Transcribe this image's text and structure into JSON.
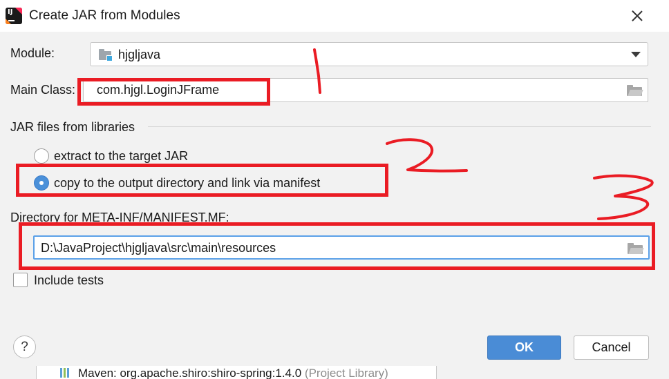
{
  "window": {
    "title": "Create JAR from Modules",
    "app_icon": "intellij-idea-icon"
  },
  "module": {
    "label": "Module:",
    "value": "hjgljava",
    "icon": "module-folder-icon"
  },
  "main_class": {
    "label": "Main Class:",
    "value": "com.hjgl.LoginJFrame"
  },
  "jar_libraries": {
    "section_title": "JAR files from libraries",
    "options": [
      {
        "label": "extract to the target JAR",
        "selected": false
      },
      {
        "label": "copy to the output directory and link via manifest",
        "selected": true
      }
    ]
  },
  "manifest": {
    "label": "Directory for META-INF/MANIFEST.MF:",
    "value": "D:\\JavaProject\\hjgljava\\src\\main\\resources"
  },
  "include_tests": {
    "label": "Include tests",
    "checked": false
  },
  "buttons": {
    "help": "?",
    "ok": "OK",
    "cancel": "Cancel"
  },
  "background_row": {
    "text": "Maven: org.apache.shiro:shiro-spring:1.4.0",
    "suffix": "(Project Library)"
  },
  "annotations": {
    "color": "#ea1c24",
    "numbers": [
      "1",
      "2",
      "3"
    ]
  }
}
